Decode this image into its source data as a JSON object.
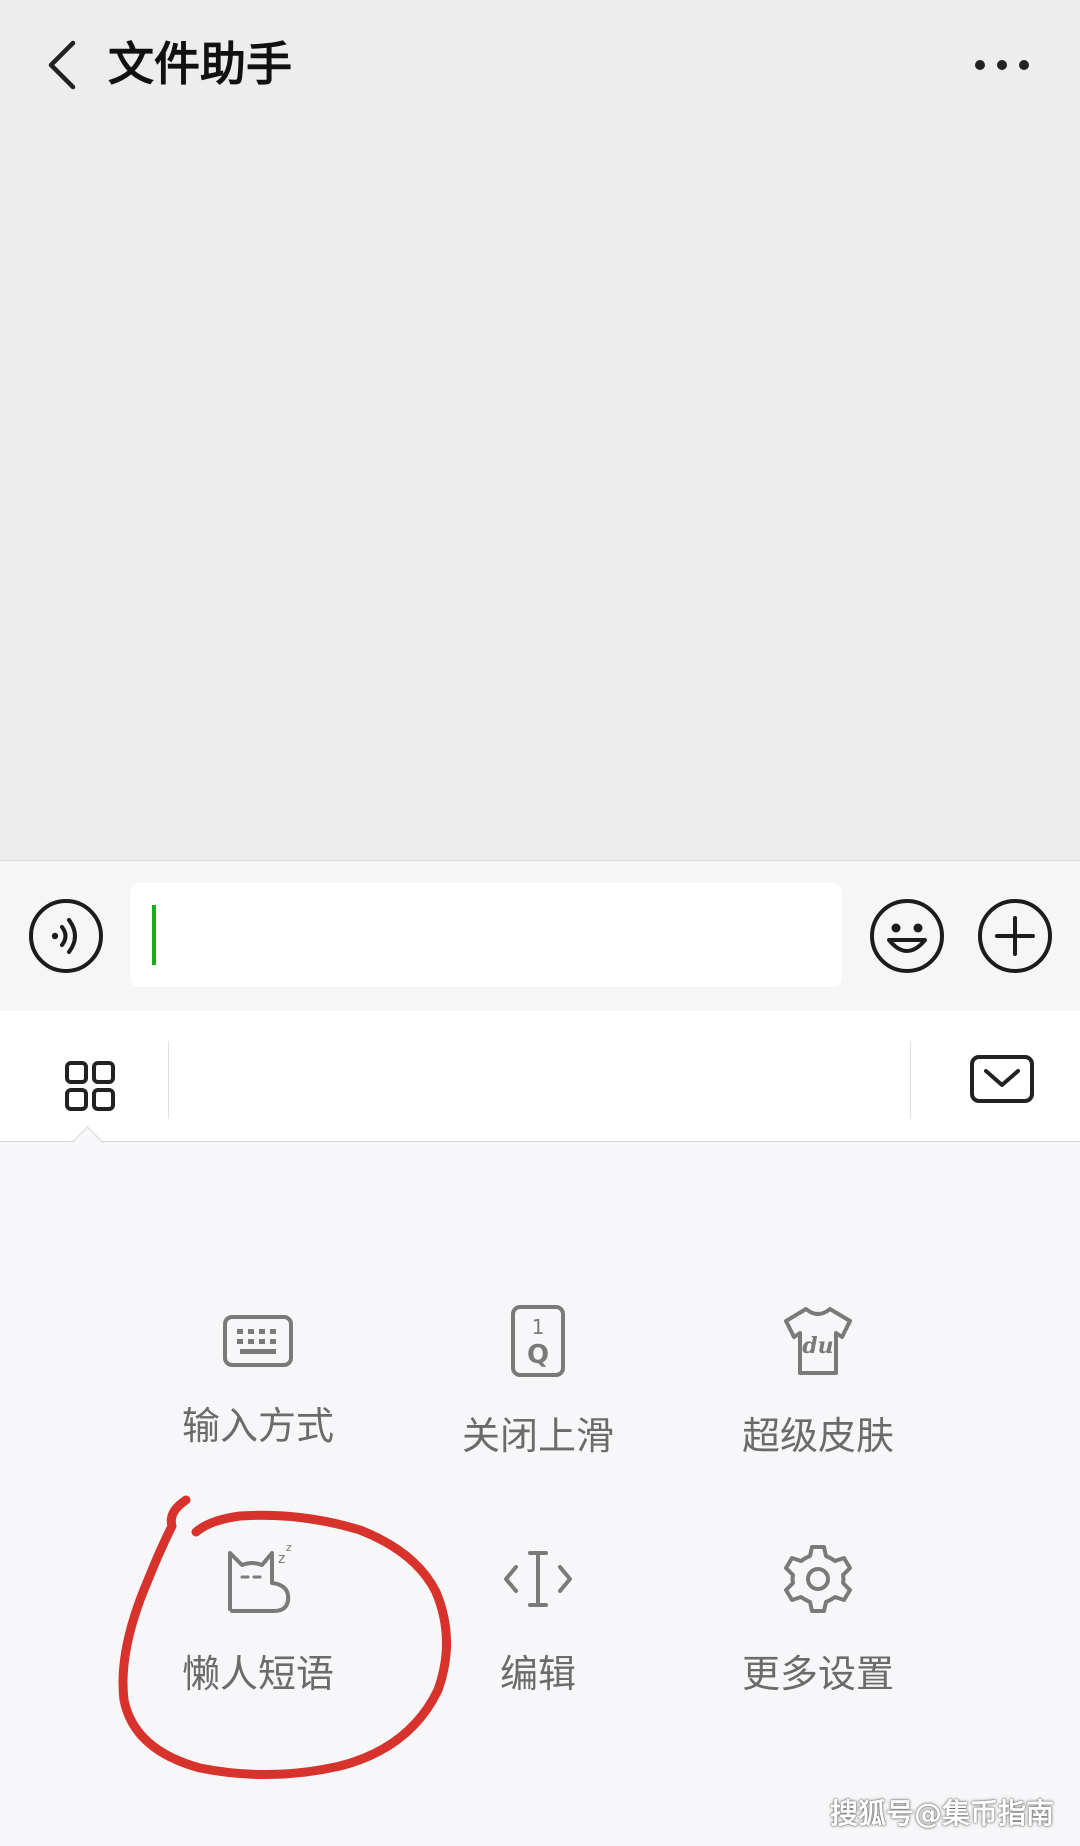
{
  "header": {
    "title": "文件助手",
    "back_icon": "chevron-left-icon",
    "more_icon": "more-horizontal-icon"
  },
  "input_bar": {
    "text_value": "",
    "voice_icon": "voice-icon",
    "emoji_icon": "emoji-icon",
    "plus_icon": "plus-icon",
    "caret_color": "#1aad19"
  },
  "keyboard_toolbar": {
    "grid_icon": "grid-icon",
    "hide_icon": "hide-keyboard-icon"
  },
  "keyboard_functions": [
    {
      "label": "输入方式",
      "icon": "keyboard-icon"
    },
    {
      "label": "关闭上滑",
      "icon": "key-1q-icon"
    },
    {
      "label": "超级皮肤",
      "icon": "tshirt-icon"
    },
    {
      "label": "懒人短语",
      "icon": "sleepy-cat-icon"
    },
    {
      "label": "编辑",
      "icon": "text-cursor-icon"
    },
    {
      "label": "更多设置",
      "icon": "gear-icon"
    }
  ],
  "annotation": {
    "color": "#d8322c",
    "target": "懒人短语"
  },
  "watermark": "搜狐号@集币指南"
}
